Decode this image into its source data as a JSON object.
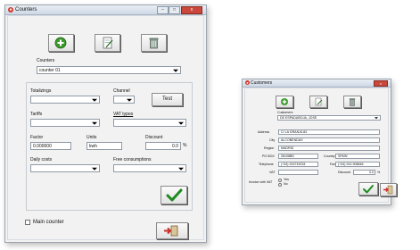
{
  "counters_window": {
    "title": "Counters",
    "title_min": "–",
    "title_max": "□",
    "title_close": "x",
    "counters_label": "Counters",
    "counter_value": "counter 01",
    "totalizings_label": "Totalizings",
    "channel_label": "Channel",
    "test_label": "Test",
    "tariffs_label": "Tariffs",
    "vat_types_label": "VAT types",
    "factor_label": "Factor",
    "factor_value": "0.000000",
    "units_label": "Units",
    "units_value": "kwh",
    "discount_label": "Discount",
    "discount_value": "0.0",
    "percent": "%",
    "daily_costs_label": "Daily costs",
    "free_consumptions_label": "Free consumptions",
    "main_counter_label": "Main counter"
  },
  "customers_window": {
    "title": "Customers",
    "customers_label": "Customers",
    "customer_value": "DE ESPADAÑOJA, JOSE",
    "address_label": "Address",
    "address_value": "C/ LA GRANJA 84",
    "city_label": "City",
    "city_value": "ALCOBENDAS",
    "region_label": "Region",
    "region_value": "MADRID",
    "pobox_label": "PO BOX",
    "pobox_value": "28108BD",
    "country_label": "Country",
    "country_value": "SPAIN",
    "telephone_label": "Telephone",
    "telephone_value": "(+34) 915749234",
    "fax_label": "Fax",
    "fax_value": "(+34) 914 908646",
    "vat_label": "VAT",
    "vat_value": "",
    "discount_label": "Discount",
    "discount_value": "0.0",
    "percent": "%",
    "invoice_label": "Invoice with VAT",
    "yes_label": "Yes",
    "no_label": "No"
  },
  "icons": [
    "add-icon",
    "edit-icon",
    "delete-icon",
    "check-icon",
    "exit-icon",
    "app-icon"
  ],
  "colors": {
    "add_green": "#3a9a2a",
    "check_green": "#1e8a1e",
    "exit_red": "#c8302a",
    "titlebar": "#d5dfeb"
  }
}
